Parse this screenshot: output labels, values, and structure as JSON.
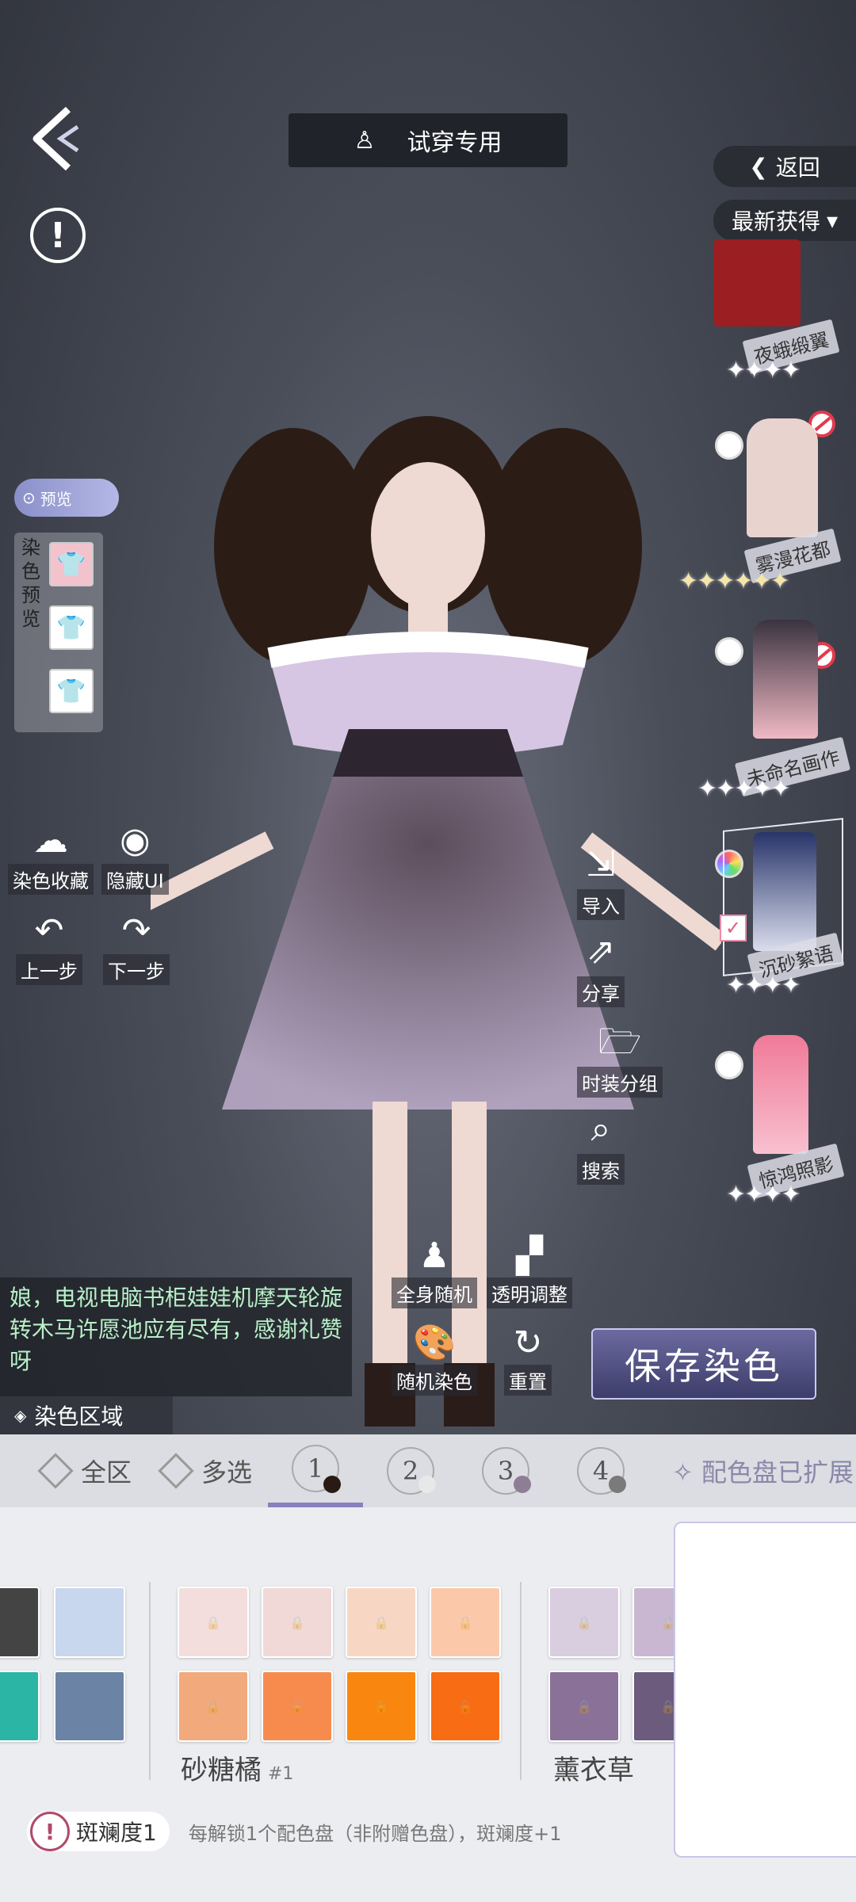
{
  "header": {
    "title": "试穿专用"
  },
  "nav": {
    "return_label": "返回",
    "sort_label": "最新获得"
  },
  "dye_preview": {
    "pill_label": "预览",
    "panel_label": "染色预览"
  },
  "left_tools": [
    {
      "icon": "dye-favorite-icon",
      "label": "染色收藏"
    },
    {
      "icon": "eye-icon",
      "label": "隐藏UI"
    },
    {
      "icon": "undo-icon",
      "label": "上一步"
    },
    {
      "icon": "redo-icon",
      "label": "下一步"
    }
  ],
  "right_actions": [
    {
      "icon": "import-icon",
      "label": "导入"
    },
    {
      "icon": "share-icon",
      "label": "分享"
    },
    {
      "icon": "folder-icon",
      "label": "时装分组"
    },
    {
      "icon": "search-icon",
      "label": "搜索"
    }
  ],
  "items": [
    {
      "name": "夜蛾缎翼",
      "stars": 4,
      "gold": false
    },
    {
      "name": "雾漫花都",
      "stars": 6,
      "gold": true
    },
    {
      "name": "未命名画作",
      "stars": 5,
      "gold": false
    },
    {
      "name": "沉砂絮语",
      "stars": 4,
      "gold": false
    },
    {
      "name": "惊鸿照影",
      "stars": 4,
      "gold": false
    }
  ],
  "chat": {
    "text": "娘，电视电脑书柜娃娃机摩天轮旋转木马许愿池应有尽有，感谢礼赞呀"
  },
  "zone_tab": "染色区域",
  "center_tools": {
    "full_random": "全身随机",
    "transparency": "透明调整",
    "random_dye": "随机染色",
    "reset": "重置"
  },
  "save_label": "保存染色",
  "tabs": {
    "all": "全区",
    "multi": "多选",
    "expanded": "配色盘已扩展",
    "slots": [
      {
        "num": "1",
        "color": "#2a1a14"
      },
      {
        "num": "2",
        "color": "#e8e8e8"
      },
      {
        "num": "3",
        "color": "#8e7e94"
      },
      {
        "num": "4",
        "color": "#7a7a7a"
      }
    ]
  },
  "palettes": [
    {
      "name": "砂糖橘",
      "sub": "#1",
      "colors": [
        "#f3dedd",
        "#f1d9d8",
        "#f7d7c4",
        "#fbc9a9",
        "#f2a97c",
        "#f78b4e",
        "#f9870f",
        "#f86c14"
      ]
    },
    {
      "name": "薰衣草",
      "sub": "",
      "colors": [
        "#d9cde0",
        "#c9b7d2",
        "#8a7198",
        "#6c5b7d"
      ]
    }
  ],
  "partial_palette": {
    "colors": [
      "#c8d6ee",
      "#6b83a4"
    ]
  },
  "footer": {
    "badge_icon": "!",
    "badge_label": "斑斓度1",
    "note": "每解锁1个配色盘（非附赠色盘），斑斓度+1"
  }
}
